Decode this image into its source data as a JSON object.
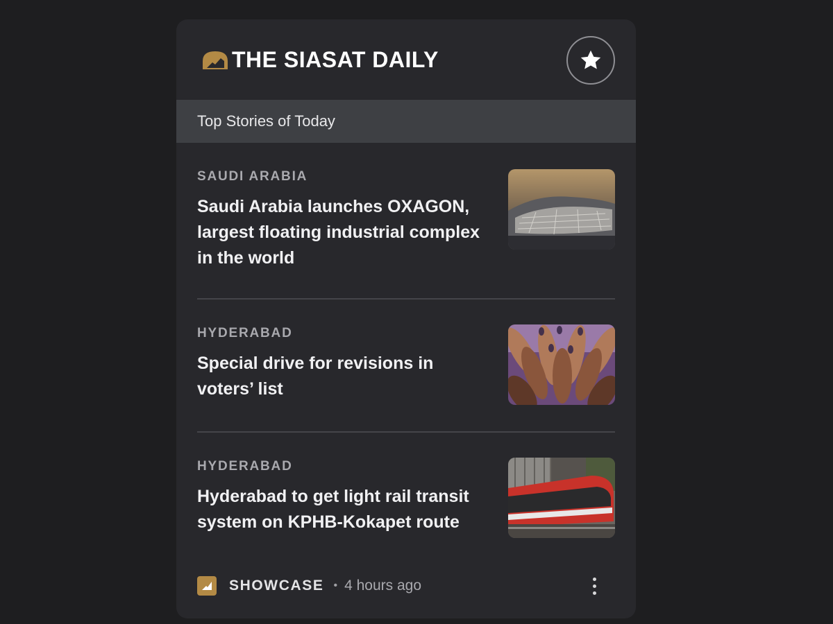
{
  "publisher": {
    "name": "THE SIASAT DAILY",
    "brand_color": "#b38a45"
  },
  "header": {
    "star_icon": "star-icon"
  },
  "section": {
    "title": "Top Stories of Today"
  },
  "stories": [
    {
      "category": "SAUDI ARABIA",
      "title": "Saudi Arabia launches OXAGON, largest floating industrial complex in the world",
      "thumbnail": "aerial-floating-complex-image"
    },
    {
      "category": "HYDERABAD",
      "title": "Special drive for revisions in voters’ list",
      "thumbnail": "inked-fingers-image"
    },
    {
      "category": "HYDERABAD",
      "title": "Hyderabad to get light rail transit system on KPHB-Kokapet route",
      "thumbnail": "red-light-rail-train-image"
    }
  ],
  "footer": {
    "label": "SHOWCASE",
    "separator": "•",
    "time": "4 hours ago",
    "menu_icon": "more-vert-icon"
  }
}
